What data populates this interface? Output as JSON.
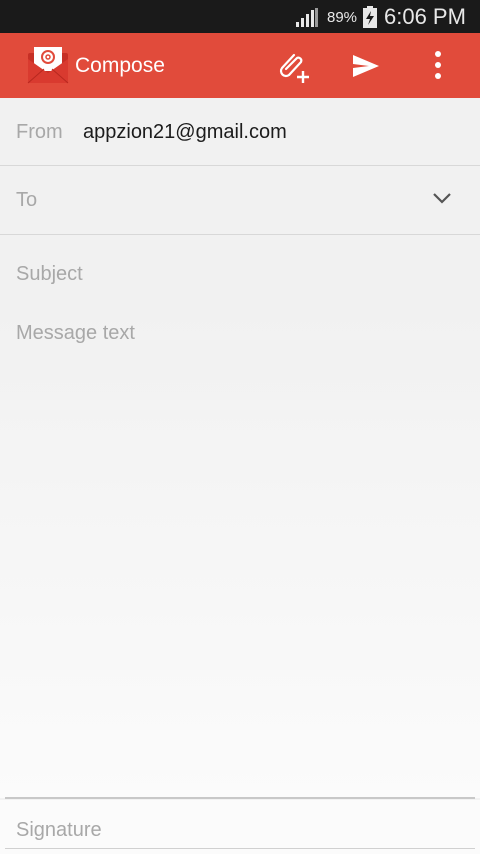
{
  "status_bar": {
    "battery_percent": "89%",
    "time": "6:06 PM",
    "icons": [
      "signal-icon",
      "battery-charging-icon"
    ]
  },
  "app_bar": {
    "title": "Compose",
    "icons": [
      "email-app-icon",
      "attach-icon",
      "send-icon",
      "overflow-menu-icon"
    ],
    "color": "#e14b3b"
  },
  "form": {
    "from_label": "From",
    "from_value": "appzion21@gmail.com",
    "to_label": "To",
    "subject_placeholder": "Subject",
    "message_placeholder": "Message text",
    "signature_placeholder": "Signature"
  }
}
